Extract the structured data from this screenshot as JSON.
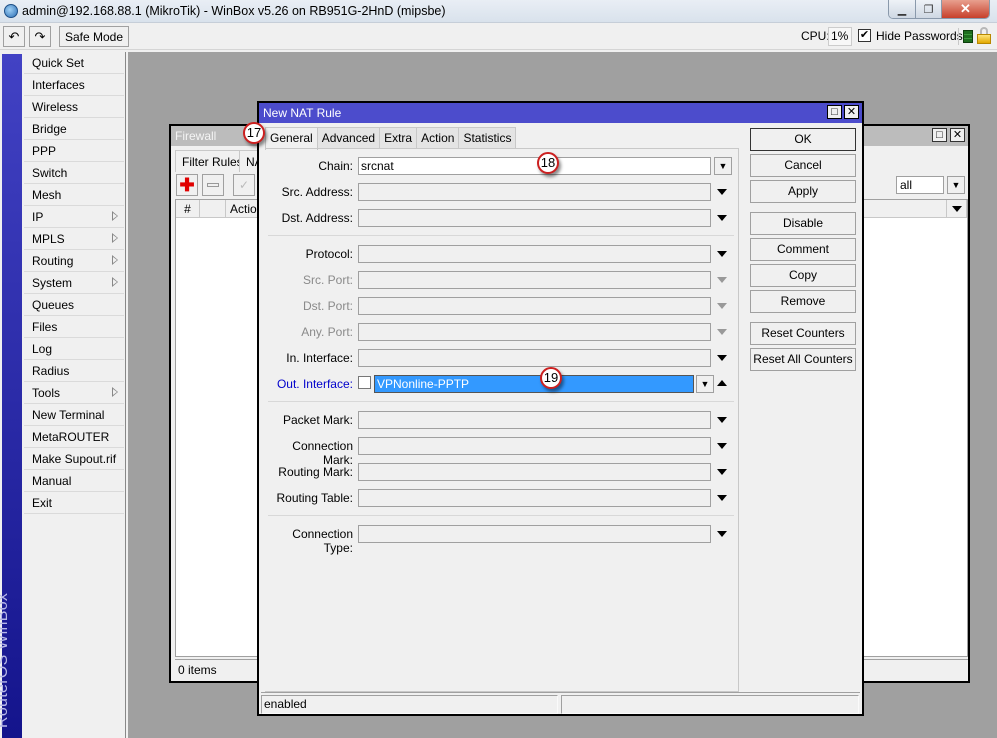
{
  "window": {
    "title": "admin@192.168.88.1 (MikroTik) - WinBox v5.26 on RB951G-2HnD (mipsbe)",
    "controls": [
      "minimize",
      "restore",
      "close"
    ]
  },
  "toolbar": {
    "undo_icon": "undo-icon",
    "redo_icon": "redo-icon",
    "safe_mode_label": "Safe Mode",
    "cpu_label": "CPU:",
    "cpu_value": "1%",
    "hide_passwords_label": "Hide Passwords",
    "hide_passwords_checked": true,
    "hide_passwords_mark": "✔"
  },
  "sidebar": {
    "brand": "RouterOS WinBox",
    "items": [
      {
        "label": "Quick Set",
        "submenu": false
      },
      {
        "label": "Interfaces",
        "submenu": false
      },
      {
        "label": "Wireless",
        "submenu": false
      },
      {
        "label": "Bridge",
        "submenu": false
      },
      {
        "label": "PPP",
        "submenu": false
      },
      {
        "label": "Switch",
        "submenu": false
      },
      {
        "label": "Mesh",
        "submenu": false
      },
      {
        "label": "IP",
        "submenu": true
      },
      {
        "label": "MPLS",
        "submenu": true
      },
      {
        "label": "Routing",
        "submenu": true
      },
      {
        "label": "System",
        "submenu": true
      },
      {
        "label": "Queues",
        "submenu": false
      },
      {
        "label": "Files",
        "submenu": false
      },
      {
        "label": "Log",
        "submenu": false
      },
      {
        "label": "Radius",
        "submenu": false
      },
      {
        "label": "Tools",
        "submenu": true
      },
      {
        "label": "New Terminal",
        "submenu": false
      },
      {
        "label": "MetaROUTER",
        "submenu": false
      },
      {
        "label": "Make Supout.rif",
        "submenu": false
      },
      {
        "label": "Manual",
        "submenu": false
      },
      {
        "label": "Exit",
        "submenu": false
      }
    ]
  },
  "firewall": {
    "title": "Firewall",
    "tabs": [
      "Filter Rules",
      "NAT"
    ],
    "columns": [
      "#",
      "",
      "Action"
    ],
    "filter_value": "all",
    "status": "0 items"
  },
  "nat_rule": {
    "title": "New NAT Rule",
    "tabs": [
      "General",
      "Advanced",
      "Extra",
      "Action",
      "Statistics"
    ],
    "active_tab": "General",
    "fields": {
      "chain": {
        "label": "Chain:",
        "value": "srcnat"
      },
      "src_address": {
        "label": "Src. Address:",
        "value": ""
      },
      "dst_address": {
        "label": "Dst. Address:",
        "value": ""
      },
      "protocol": {
        "label": "Protocol:",
        "value": ""
      },
      "src_port": {
        "label": "Src. Port:",
        "value": ""
      },
      "dst_port": {
        "label": "Dst. Port:",
        "value": ""
      },
      "any_port": {
        "label": "Any. Port:",
        "value": ""
      },
      "in_interface": {
        "label": "In. Interface:",
        "value": ""
      },
      "out_interface": {
        "label": "Out. Interface:",
        "value": "VPNonline-PPTP",
        "negate": false
      },
      "packet_mark": {
        "label": "Packet Mark:",
        "value": ""
      },
      "connection_mark": {
        "label": "Connection Mark:",
        "value": ""
      },
      "routing_mark": {
        "label": "Routing Mark:",
        "value": ""
      },
      "routing_table": {
        "label": "Routing Table:",
        "value": ""
      },
      "connection_type": {
        "label": "Connection Type:",
        "value": ""
      }
    },
    "buttons": {
      "ok": "OK",
      "cancel": "Cancel",
      "apply": "Apply",
      "disable": "Disable",
      "comment": "Comment",
      "copy": "Copy",
      "remove": "Remove",
      "reset_counters": "Reset Counters",
      "reset_all_counters": "Reset All Counters"
    },
    "status": "enabled"
  },
  "annotations": {
    "step_17": "17",
    "step_18": "18",
    "step_19": "19"
  },
  "colors": {
    "dialog_title_bg": "#4c4ccc",
    "sidebar_band": "#2a2aa8",
    "selection": "#3399ff",
    "out_interface_label": "#0000cc",
    "badge_border": "#cc2020"
  }
}
